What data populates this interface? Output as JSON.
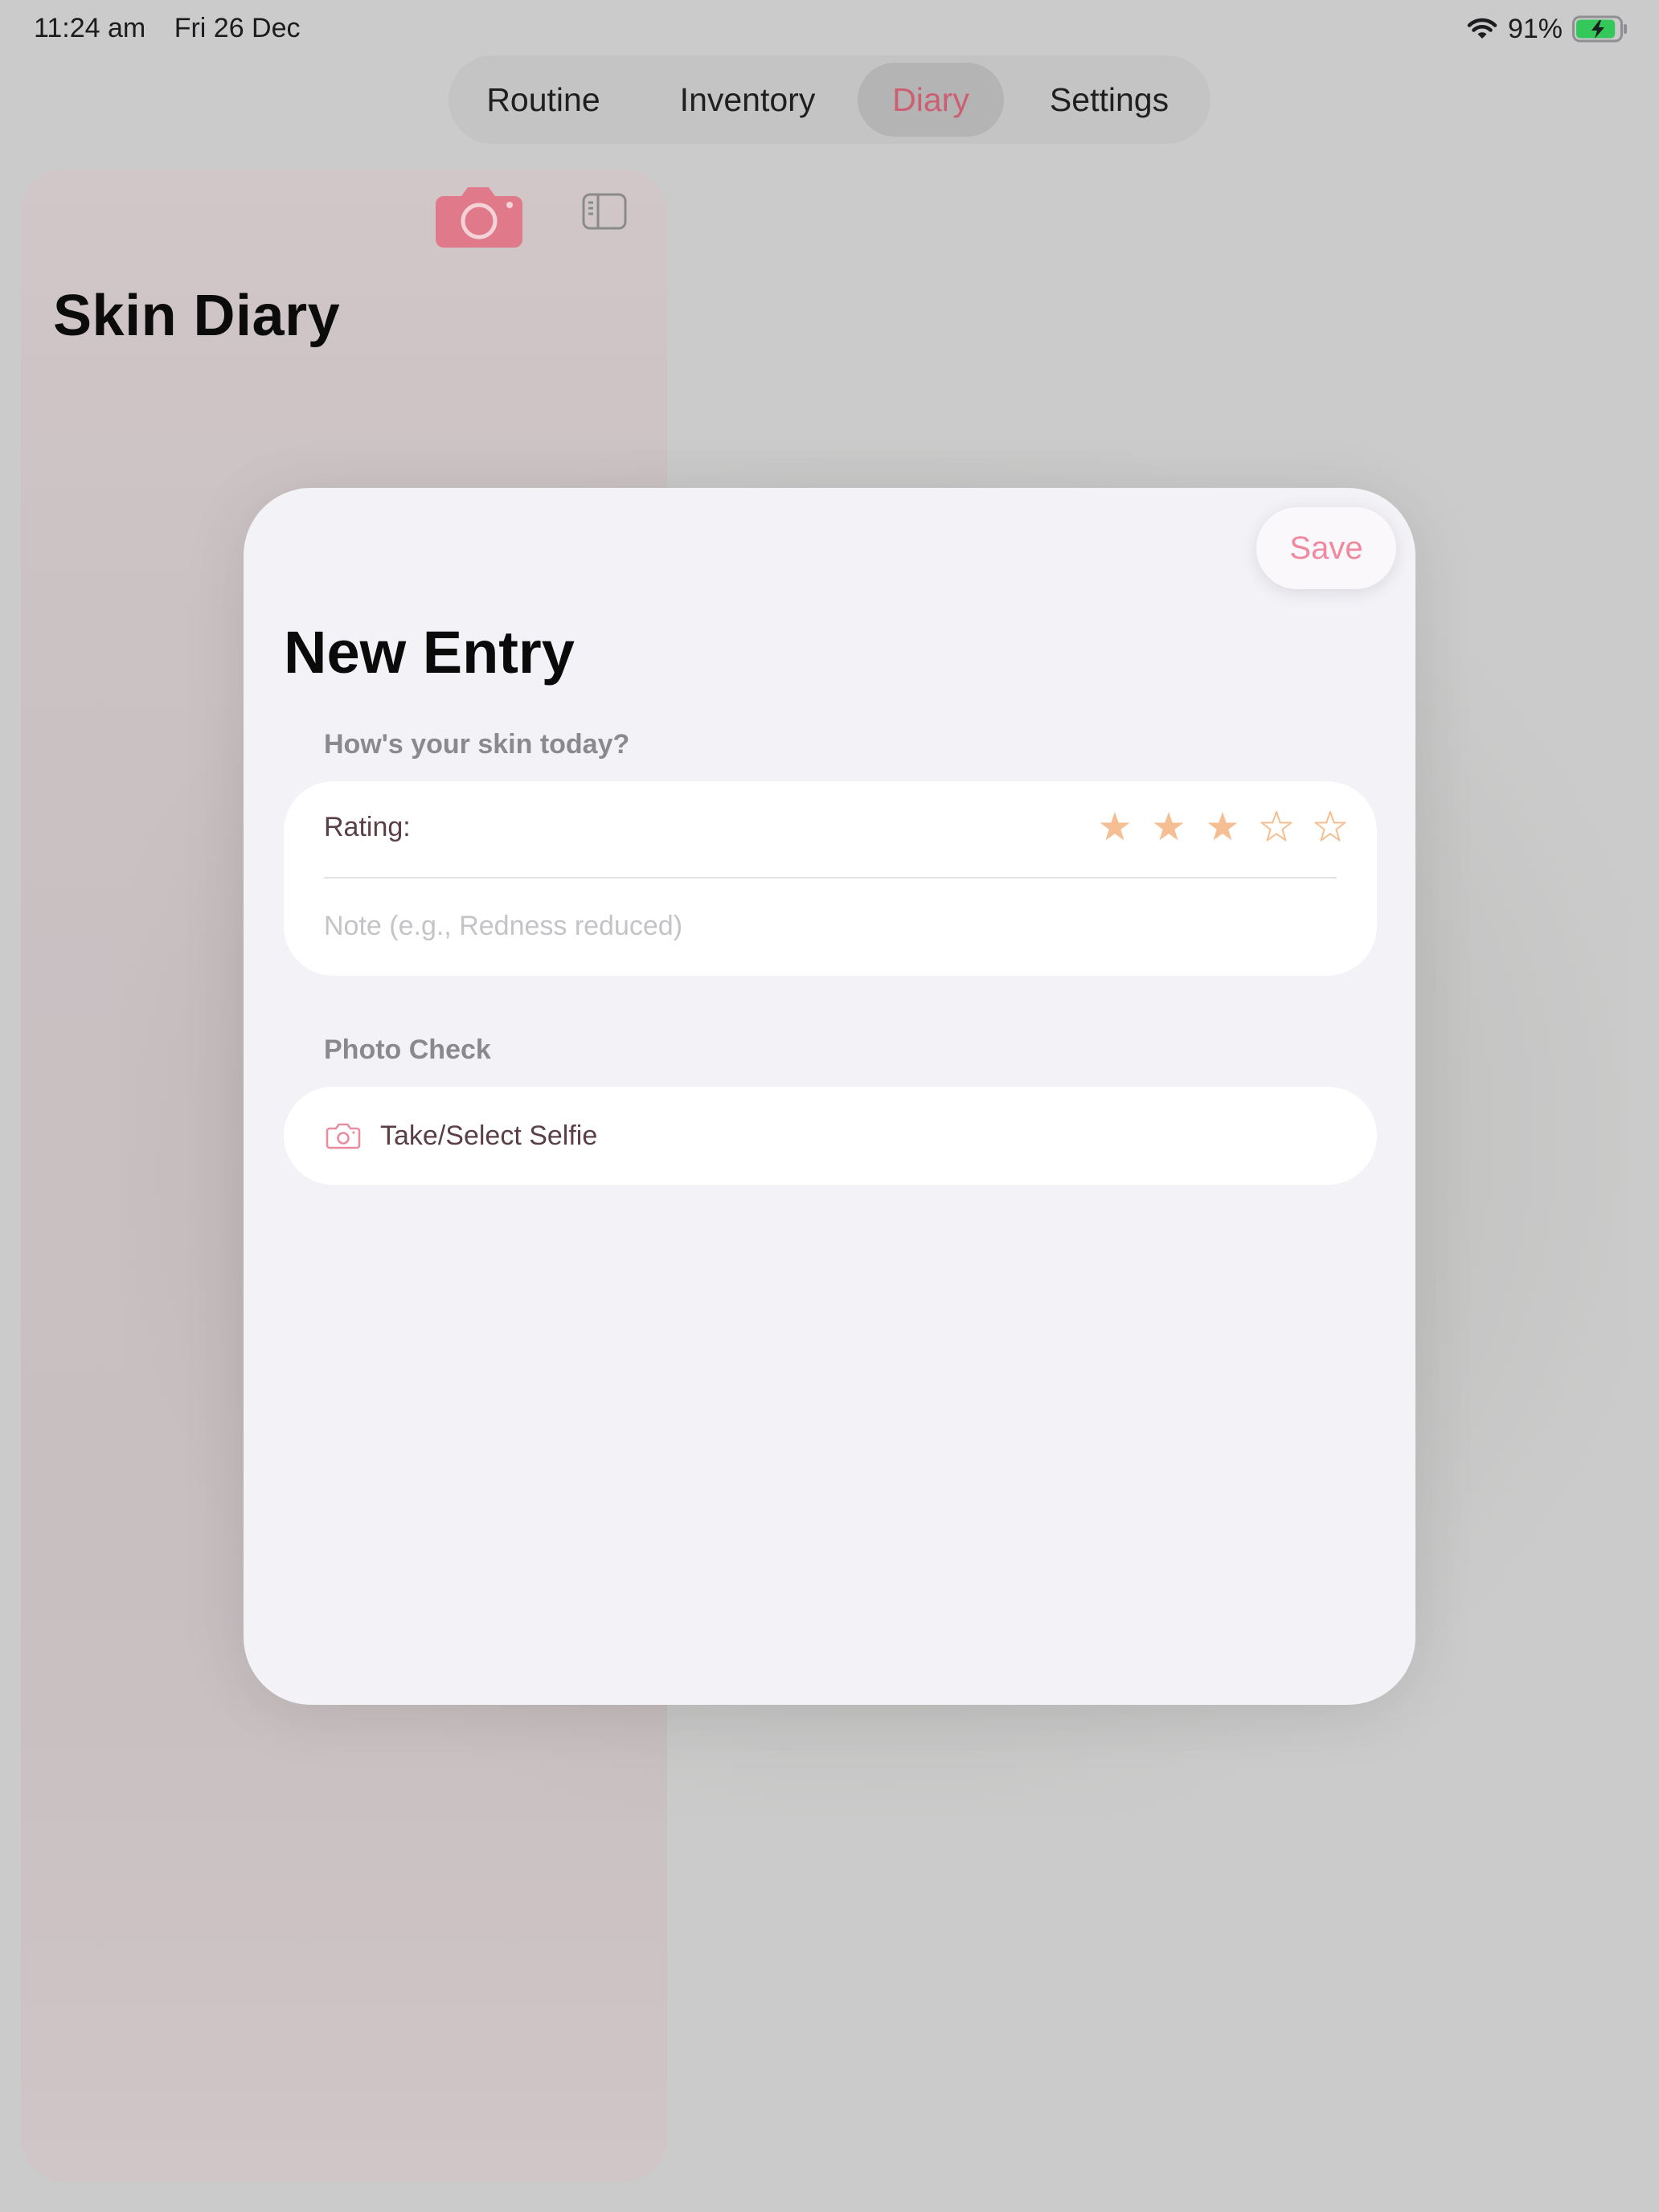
{
  "status_bar": {
    "time": "11:24 am",
    "date": "Fri 26 Dec",
    "battery_percent": "91%",
    "battery_level": 0.91,
    "charging": true,
    "icons": [
      "wifi-icon",
      "battery-icon"
    ]
  },
  "tabs": [
    {
      "label": "Routine",
      "active": false
    },
    {
      "label": "Inventory",
      "active": false
    },
    {
      "label": "Diary",
      "active": true
    },
    {
      "label": "Settings",
      "active": false
    }
  ],
  "sidebar": {
    "title": "Skin Diary",
    "icons": [
      "camera-icon",
      "sidebar-toggle-icon"
    ]
  },
  "modal": {
    "save_label": "Save",
    "title": "New Entry",
    "skin_section_header": "How's your skin today?",
    "rating_label": "Rating:",
    "rating_value": 3,
    "rating_max": 5,
    "note_placeholder": "Note (e.g., Redness reduced)",
    "note_value": "",
    "photo_section_header": "Photo Check",
    "selfie_label": "Take/Select Selfie"
  },
  "colors": {
    "accent": "#cc5f72",
    "save_text": "#f0899f",
    "star": "#f6bf93",
    "camera": "#e07a8a",
    "battery_fill": "#34c759"
  }
}
